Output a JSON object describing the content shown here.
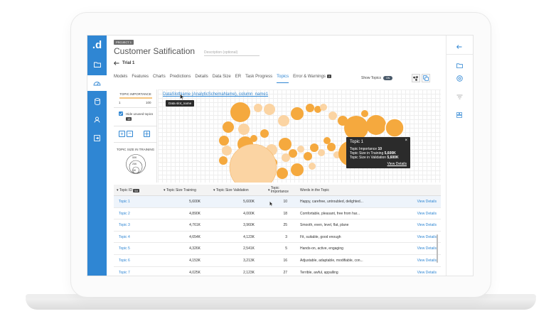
{
  "project_badge": "PROJECT 1",
  "title": "Customer Satification",
  "description_placeholder": "Description (optional)",
  "trial_label": "Trial 1",
  "tabs": [
    {
      "label": "Models"
    },
    {
      "label": "Features"
    },
    {
      "label": "Charts"
    },
    {
      "label": "Predictions"
    },
    {
      "label": "Details"
    },
    {
      "label": "Data Size"
    },
    {
      "label": "ER"
    },
    {
      "label": "Task Progress"
    },
    {
      "label": "Topics"
    },
    {
      "label": "Error & Warnings",
      "count": "2"
    }
  ],
  "active_tab": "Topics",
  "show_topics": {
    "label": "Show Topics",
    "toggle": "ON"
  },
  "panel": {
    "topic_importance_label": "TOPIC IMPORTANCE",
    "importance_min": "1",
    "importance_max": "100",
    "hide_unused_label": "Hide unused topics",
    "hide_unused_count": "15",
    "topic_size_label": "TOPIC SIZE IN TRAINING",
    "size_legend": [
      "50K",
      "25K",
      "5K"
    ]
  },
  "chart": {
    "slot_link": "DataSlotName (AnalyticSchemaName), column_name1",
    "slot_tooltip": "Data slot_name"
  },
  "tooltip": {
    "title": "Topic 1",
    "rows": [
      {
        "label": "Topic Importance",
        "value": "10"
      },
      {
        "label": "Topic Size in Training",
        "value": "5,600K"
      },
      {
        "label": "Topic Size in Validation",
        "value": "5,600K"
      }
    ],
    "link": "View Details"
  },
  "table": {
    "headers": {
      "id": "Topic ID",
      "id_count": "54",
      "training": "Topic Size Training",
      "validation": "Topic Size Validation",
      "importance": "Topic Importance",
      "words": "Words in the Topic"
    },
    "rows": [
      {
        "id": "Topic 1",
        "training": "5,600K",
        "validation": "5,600K",
        "importance": "10",
        "words": "Happy, carefree, untroubled, delighted...",
        "link": "View Details"
      },
      {
        "id": "Topic 2",
        "training": "4,890K",
        "validation": "4,000K",
        "importance": "18",
        "words": "Comfortable, pleasant, free from har...",
        "link": "View Details"
      },
      {
        "id": "Topic 3",
        "training": "4,761K",
        "validation": "3,960K",
        "importance": "25",
        "words": "Smooth, even, level, flat, plane",
        "link": "View Details"
      },
      {
        "id": "Topic 4",
        "training": "4,654K",
        "validation": "4,123K",
        "importance": "3",
        "words": "Fit, suitable, good enough",
        "link": "View Details"
      },
      {
        "id": "Topic 5",
        "training": "4,326K",
        "validation": "2,541K",
        "importance": "5",
        "words": "Hands-on, active, engaging",
        "link": "View Details"
      },
      {
        "id": "Topic 6",
        "training": "4,153K",
        "validation": "3,213K",
        "importance": "16",
        "words": "Adjustable, adaptable, modifiable, con...",
        "link": "View Details"
      },
      {
        "id": "Topic 7",
        "training": "4,025K",
        "validation": "2,123K",
        "importance": "27",
        "words": "Terrible, awful, appalling",
        "link": "View Details"
      }
    ]
  },
  "colors": {
    "accent": "#2f86d3",
    "bubble": "#f5a93e",
    "bubble_light": "#fbd4a3"
  }
}
